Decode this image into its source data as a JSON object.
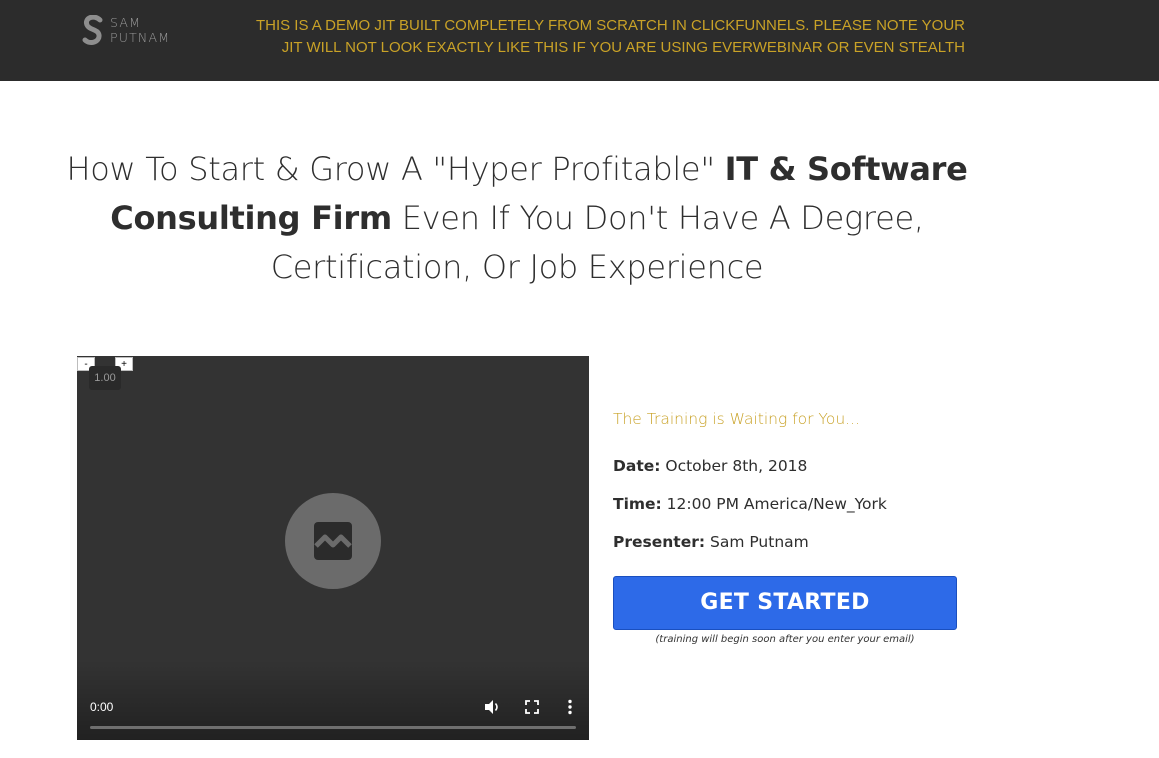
{
  "header": {
    "logo_line1": "SAM",
    "logo_line2": "PUTNAM",
    "notice_line1": "THIS IS A DEMO JIT BUILT COMPLETELY FROM SCRATCH IN CLICKFUNNELS. PLEASE NOTE YOUR",
    "notice_line2": "JIT WILL NOT LOOK EXACTLY LIKE THIS IF YOU ARE USING EVERWEBINAR OR EVEN STEALTH"
  },
  "headline": {
    "part1": "How To Start & Grow A \"Hyper Profitable\" ",
    "bold1": "IT & Software Consulting Firm",
    "part2": " Even If You Don't Have A Degree, Certification, Or Job Experience"
  },
  "video": {
    "speed_minus": "-",
    "speed_plus": "+",
    "speed_value": "1.00",
    "current_time": "0:00",
    "icons": [
      "broken-image-icon",
      "volume-icon",
      "fullscreen-icon",
      "more-options-icon"
    ]
  },
  "panel": {
    "waiting": "The Training is Waiting for You...",
    "date_label": "Date:",
    "date_value": " October 8th, 2018",
    "time_label": "Time:",
    "time_value": " 12:00 PM America/New_York",
    "presenter_label": "Presenter:",
    "presenter_value": " Sam Putnam",
    "cta_label": "GET STARTED",
    "cta_sub": "(training will begin soon after you enter your email)"
  },
  "colors": {
    "header_bg": "#2c2c2c",
    "accent_gold": "#c9a227",
    "cta_blue": "#2d6ae8",
    "video_bg": "#333333"
  }
}
